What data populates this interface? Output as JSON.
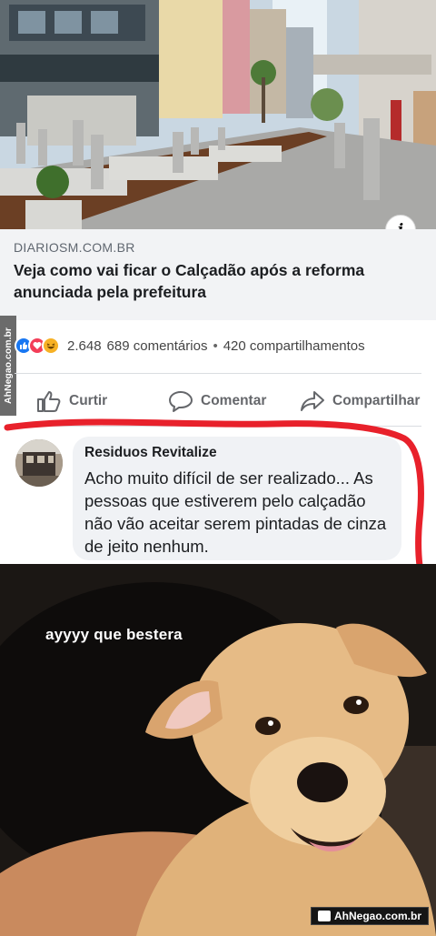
{
  "link_preview": {
    "domain": "DIARIOSM.COM.BR",
    "title": "Veja como vai ficar o Calçadão após a reforma anunciada pela prefeitura",
    "info_icon": "i"
  },
  "watermark_side": "AhNegao.com.br",
  "reactions": {
    "icons": [
      "like-icon",
      "love-icon",
      "haha-icon"
    ],
    "count": "2.648",
    "comments": "689 comentários",
    "separator": "•",
    "shares": "420 compartilhamentos"
  },
  "actions": {
    "like": "Curtir",
    "comment": "Comentar",
    "share": "Compartilhar"
  },
  "comment": {
    "author": "Residuos Revitalize",
    "text": "Acho muito difícil de ser realizado... As pessoas que estiverem pelo calçadão não vão aceitar serem pintadas de cinza de jeito nenhum."
  },
  "meme": {
    "caption": "ayyyy que bestera",
    "watermark": "AhNegao.com.br"
  },
  "colors": {
    "facebook_blue": "#1877f2",
    "love_red": "#f33e58",
    "haha_yellow": "#f7b125",
    "highlight_red": "#e8212b",
    "meta_bg": "#f2f3f5"
  }
}
